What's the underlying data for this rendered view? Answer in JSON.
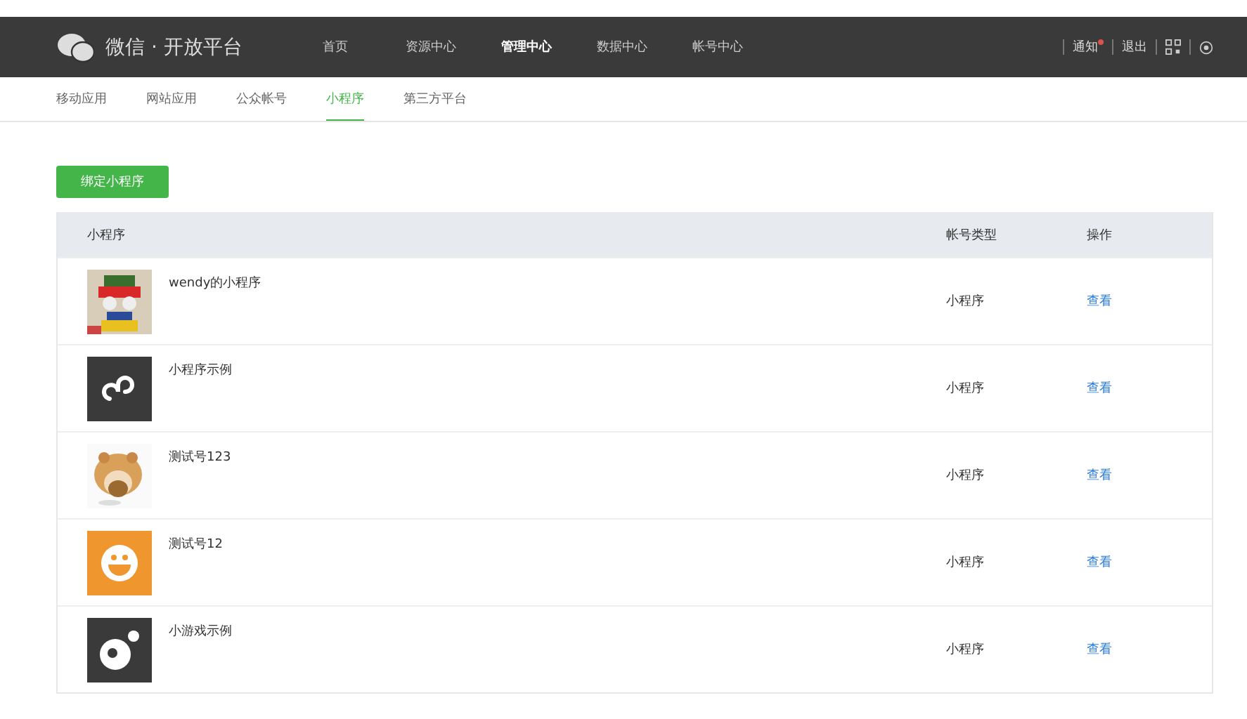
{
  "header": {
    "brand": "微信 · 开放平台",
    "nav": [
      {
        "label": "首页",
        "selected": false
      },
      {
        "label": "资源中心",
        "selected": false
      },
      {
        "label": "管理中心",
        "selected": true
      },
      {
        "label": "数据中心",
        "selected": false
      },
      {
        "label": "帐号中心",
        "selected": false
      }
    ],
    "notice": {
      "label": "通知",
      "unread": true
    },
    "logout": "退出"
  },
  "tabs": [
    {
      "label": "移动应用",
      "selected": false
    },
    {
      "label": "网站应用",
      "selected": false
    },
    {
      "label": "公众帐号",
      "selected": false
    },
    {
      "label": "小程序",
      "selected": true
    },
    {
      "label": "第三方平台",
      "selected": false
    }
  ],
  "bind_button": "绑定小程序",
  "table": {
    "columns": [
      "小程序",
      "帐号类型",
      "操作"
    ],
    "rows": [
      {
        "kind": "picture",
        "name": "wendy的小程序",
        "type": "小程序",
        "action": "查看"
      },
      {
        "kind": "link",
        "name": "小程序示例",
        "type": "小程序",
        "action": "查看"
      },
      {
        "kind": "picture",
        "name": "测试号123",
        "type": "小程序",
        "action": "查看"
      },
      {
        "kind": "smile",
        "name": "测试号12",
        "type": "小程序",
        "action": "查看"
      },
      {
        "kind": "game",
        "name": "小游戏示例",
        "type": "小程序",
        "action": "查看"
      }
    ]
  }
}
